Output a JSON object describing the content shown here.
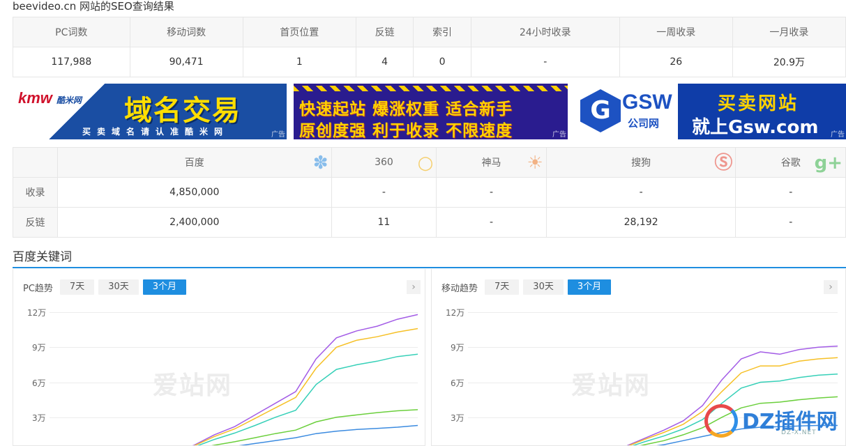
{
  "page_title": "beevideo.cn 网站的SEO查询结果",
  "seo_table": {
    "headers": [
      "PC词数",
      "移动词数",
      "首页位置",
      "反链",
      "索引",
      "24小时收录",
      "一周收录",
      "一月收录"
    ],
    "values": [
      "117,988",
      "90,471",
      "1",
      "4",
      "0",
      "-",
      "26",
      "20.9万"
    ]
  },
  "ads": {
    "ad1": {
      "logo": "kmw",
      "logo_small": "酷米网",
      "big": "域名交易",
      "sub": "买卖域名请认准酷米网",
      "tag": "广告"
    },
    "ad2": {
      "line1": "快速起站 爆涨权重 适合新手",
      "line2": "原创度强 利于收录 不限速度",
      "tag": "广告"
    },
    "ad3": {
      "logo": "GSW",
      "logo_sub": "公司网",
      "line1": "买卖网站",
      "line2": "就上Gsw.com",
      "tag": "广告"
    }
  },
  "engine_table": {
    "engines": [
      "百度",
      "360",
      "神马",
      "搜狗",
      "谷歌"
    ],
    "rows": [
      {
        "label": "收录",
        "values": [
          "4,850,000",
          "-",
          "-",
          "-",
          "-"
        ]
      },
      {
        "label": "反链",
        "values": [
          "2,400,000",
          "11",
          "-",
          "28,192",
          "-"
        ]
      }
    ],
    "icon_colors": [
      "#2e8fe3",
      "#f5b000",
      "#ef7a28",
      "#e7473a",
      "#39b44a"
    ]
  },
  "section_title": "百度关键词",
  "pc_panel": {
    "label": "PC趋势",
    "tabs": [
      "7天",
      "30天",
      "3个月"
    ],
    "active_tab": "3个月",
    "y_ticks": [
      "12万",
      "9万",
      "6万",
      "3万"
    ],
    "watermark": "爱站网"
  },
  "mobile_panel": {
    "label": "移动趋势",
    "tabs": [
      "7天",
      "30天",
      "3个月"
    ],
    "active_tab": "3个月",
    "y_ticks": [
      "12万",
      "9万",
      "6万",
      "3万"
    ],
    "watermark": "爱站网"
  },
  "chart_data": [
    {
      "type": "line",
      "y_range": [
        0,
        120000
      ],
      "y_tick_labels": [
        "3万",
        "6万",
        "9万",
        "12万"
      ],
      "series": [
        {
          "color": "#a35ce6",
          "values": [
            0,
            6000,
            15000,
            22000,
            32000,
            42000,
            52000,
            80000,
            98000,
            104000,
            108000,
            114000,
            118000
          ]
        },
        {
          "color": "#f6c026",
          "values": [
            0,
            5500,
            13500,
            20000,
            29000,
            38000,
            47000,
            72000,
            90000,
            96000,
            99000,
            103000,
            106000
          ]
        },
        {
          "color": "#36d0b8",
          "values": [
            0,
            4500,
            11000,
            16500,
            23000,
            30000,
            36000,
            58000,
            71000,
            75000,
            78000,
            82000,
            84000
          ]
        },
        {
          "color": "#6bcf3c",
          "values": [
            0,
            2500,
            6000,
            9000,
            12500,
            16000,
            19000,
            26000,
            30000,
            32000,
            34000,
            35500,
            36500
          ]
        },
        {
          "color": "#3b8be0",
          "values": [
            0,
            1000,
            3000,
            5000,
            7500,
            10000,
            12500,
            16000,
            18000,
            19500,
            20500,
            21500,
            23000
          ]
        }
      ]
    },
    {
      "type": "line",
      "y_range": [
        0,
        120000
      ],
      "y_tick_labels": [
        "3万",
        "6万",
        "9万",
        "12万"
      ],
      "series": [
        {
          "color": "#a35ce6",
          "values": [
            0,
            5000,
            12000,
            19000,
            27000,
            40000,
            62000,
            80000,
            86000,
            84000,
            88000,
            90000,
            91000
          ]
        },
        {
          "color": "#f6c026",
          "values": [
            0,
            4500,
            11000,
            17000,
            24000,
            35000,
            52000,
            68000,
            74000,
            74000,
            78000,
            80000,
            81000
          ]
        },
        {
          "color": "#36d0b8",
          "values": [
            0,
            3500,
            9000,
            14000,
            20000,
            28000,
            42000,
            55000,
            60000,
            61000,
            64000,
            66000,
            67000
          ]
        },
        {
          "color": "#6bcf3c",
          "values": [
            0,
            2500,
            6500,
            10000,
            15000,
            21000,
            30000,
            38000,
            42000,
            43000,
            45000,
            46500,
            47500
          ]
        },
        {
          "color": "#3b8be0",
          "values": [
            0,
            1500,
            4000,
            6500,
            10000,
            13500,
            17000,
            20000,
            21500,
            22000,
            22500,
            23000,
            23000
          ]
        }
      ]
    }
  ],
  "dz_badge": {
    "text": "DZ插件网",
    "sub": "DZ-X.NET"
  }
}
